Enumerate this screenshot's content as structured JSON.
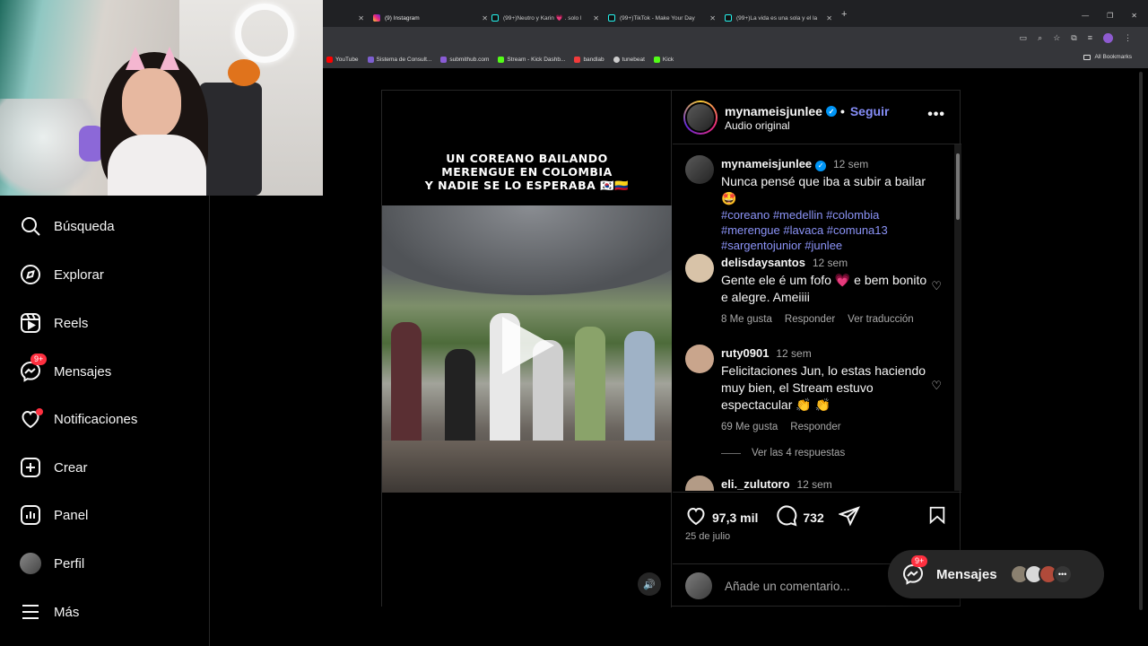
{
  "browser": {
    "tabs": [
      {
        "title": "",
        "icon": "blank-tab-icon"
      },
      {
        "title": "(9) Instagram",
        "icon": "instagram-icon",
        "color": "#e1306c"
      },
      {
        "title": "(99+)Neutro y Karin 💗 . solo l",
        "icon": "tiktok-icon"
      },
      {
        "title": "(99+)TikTok - Make Your Day",
        "icon": "tiktok-icon"
      },
      {
        "title": "(99+)La vida es una sola y el la",
        "icon": "tiktok-icon"
      }
    ],
    "bookmarks": [
      {
        "label": "YouTube",
        "color": "#ff0000"
      },
      {
        "label": "Sistema de Consult...",
        "color": "#7d5fd0"
      },
      {
        "label": "submithub.com",
        "color": "#8a5cd6"
      },
      {
        "label": "Stream - Kick Dashb...",
        "color": "#53fc18"
      },
      {
        "label": "bandlab",
        "color": "#f23b3b"
      },
      {
        "label": "tunebeat",
        "color": "#cccccc"
      },
      {
        "label": "Kick",
        "color": "#53fc18"
      }
    ],
    "all_bookmarks": "All Bookmarks"
  },
  "sidebar": {
    "items": [
      {
        "label": "Búsqueda",
        "icon": "search-icon"
      },
      {
        "label": "Explorar",
        "icon": "compass-icon"
      },
      {
        "label": "Reels",
        "icon": "reels-icon"
      },
      {
        "label": "Mensajes",
        "icon": "messenger-icon",
        "badge": "9+"
      },
      {
        "label": "Notificaciones",
        "icon": "heart-icon",
        "dot": true
      },
      {
        "label": "Crear",
        "icon": "plus-square-icon"
      },
      {
        "label": "Panel",
        "icon": "chart-icon"
      },
      {
        "label": "Perfil",
        "icon": "profile-avatar"
      },
      {
        "label": "Más",
        "icon": "menu-icon"
      }
    ]
  },
  "post": {
    "video_caption": [
      "UN COREANO BAILANDO",
      "MERENGUE EN COLOMBIA",
      "Y NADIE SE LO ESPERABA 🇰🇷🇨🇴"
    ],
    "author": "mynameisjunlee",
    "follow": "Seguir",
    "audio": "Audio original",
    "caption": {
      "user": "mynameisjunlee",
      "time": "12 sem",
      "text": "Nunca pensé que iba a subir a bailar 🤩",
      "tags": "#coreano #medellin #colombia #merengue #lavaca #comuna13 #sargentojunior #junlee"
    },
    "comments": [
      {
        "user": "delisdaysantos",
        "time": "12 sem",
        "text": "Gente ele é um fofo 💗 e bem bonito e alegre. Ameiiii",
        "likes": "8 Me gusta",
        "reply": "Responder",
        "translate": "Ver traducción",
        "avatar_color": "#d8c3a8"
      },
      {
        "user": "ruty0901",
        "time": "12 sem",
        "text": "Felicitaciones Jun, lo estas haciendo muy bien, el Stream estuvo espectacular 👏 👏",
        "likes": "69 Me gusta",
        "reply": "Responder",
        "avatar_color": "#c9a58c"
      },
      {
        "user": "eli._zulutoro",
        "time": "12 sem",
        "avatar_color": "#b39b86"
      }
    ],
    "view_replies": "Ver las 4 respuestas",
    "likes": "97,3 mil",
    "comment_count": "732",
    "date": "25 de julio",
    "add_comment_placeholder": "Añade un comentario..."
  },
  "messages_pill": {
    "label": "Mensajes",
    "badge": "9+"
  }
}
